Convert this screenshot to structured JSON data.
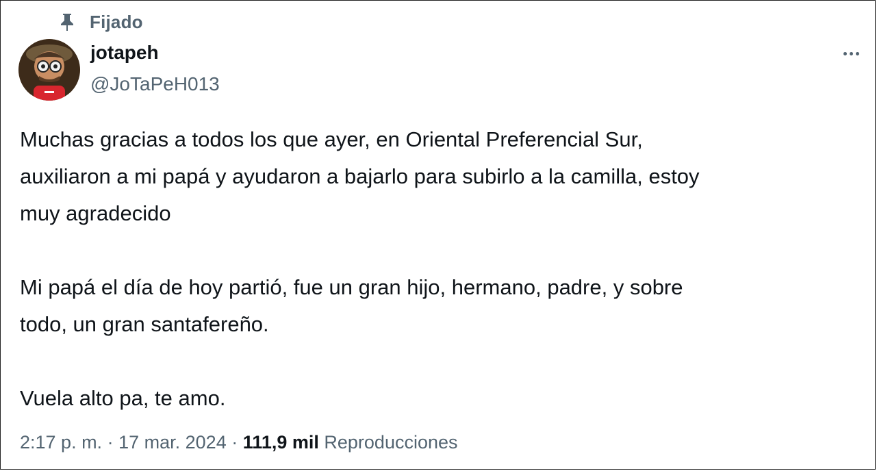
{
  "pinned": {
    "icon": "pin-icon",
    "label": "Fijado"
  },
  "author": {
    "name": "jotapeh",
    "handle": "@JoTaPeH013",
    "avatar_icon": "avatar-cartoon-icon"
  },
  "more_icon": "more-dots-icon",
  "tweet": {
    "paragraphs": [
      "Muchas gracias a todos los que ayer, en Oriental Preferencial Sur,",
      "auxiliaron a mi papá y ayudaron a bajarlo para subirlo a la camilla, estoy",
      "muy agradecido",
      "Mi papá el día de hoy partió, fue un gran hijo, hermano, padre, y sobre",
      "todo, un gran santafereño.",
      "Vuela alto pa, te amo."
    ]
  },
  "meta": {
    "time": "2:17 p. m.",
    "separator": "·",
    "date": "17 mar. 2024",
    "views_count": "111,9 mil",
    "views_label": "Reproducciones"
  },
  "colors": {
    "text_primary": "#0f1419",
    "text_secondary": "#536471",
    "background": "#ffffff",
    "border": "#1f1f1f"
  }
}
